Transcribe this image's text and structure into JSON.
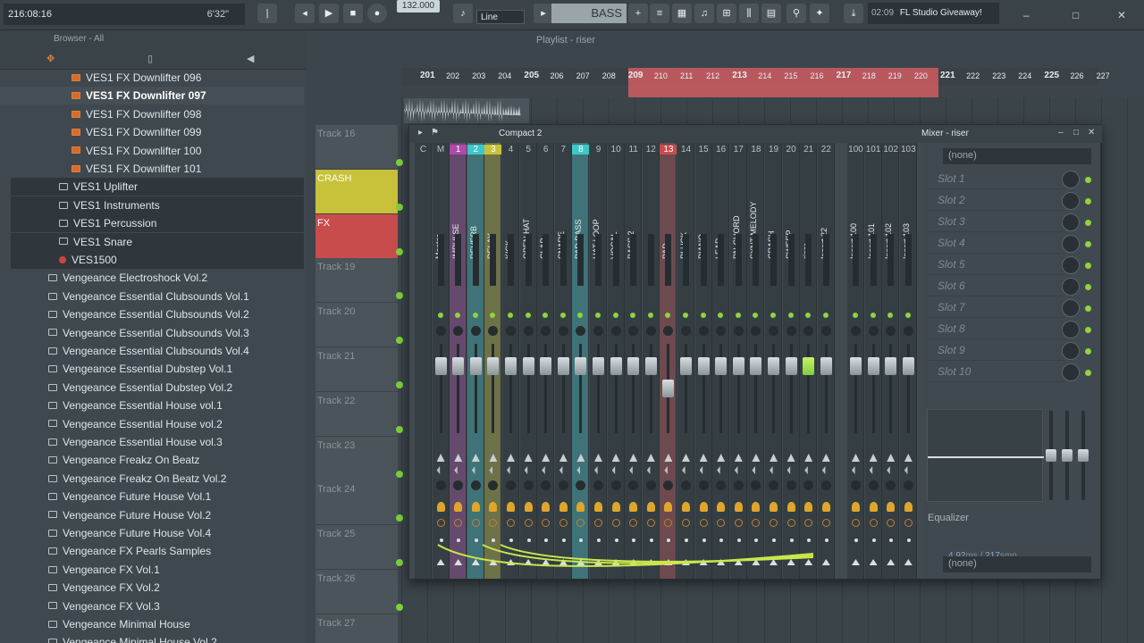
{
  "toolbar": {
    "hint_time": "216:08:16",
    "hint_right": "6'32\"",
    "tempo": "132.000",
    "line_mode": "Line",
    "pattern_name": "BASS",
    "news_time": "02:09",
    "news_text": "FL Studio Giveaway!"
  },
  "browser": {
    "title": "Browser - All",
    "items": [
      {
        "label": "VES1 FX Downlifter 096",
        "kind": "file"
      },
      {
        "label": "VES1 FX Downlifter 097",
        "kind": "file",
        "selected": true
      },
      {
        "label": "VES1 FX Downlifter 098",
        "kind": "file"
      },
      {
        "label": "VES1 FX Downlifter 099",
        "kind": "file"
      },
      {
        "label": "VES1 FX Downlifter 100",
        "kind": "file"
      },
      {
        "label": "VES1 FX Downlifter 101",
        "kind": "file"
      },
      {
        "label": "VES1 Uplifter",
        "kind": "folder"
      },
      {
        "label": "VES1 Instruments",
        "kind": "folder"
      },
      {
        "label": "VES1 Percussion",
        "kind": "folder"
      },
      {
        "label": "VES1 Snare",
        "kind": "folder"
      },
      {
        "label": "VES1500",
        "kind": "pack"
      },
      {
        "label": "Vengeance Electroshock Vol.2",
        "kind": "folder"
      },
      {
        "label": "Vengeance Essential Clubsounds Vol.1",
        "kind": "folder"
      },
      {
        "label": "Vengeance Essential Clubsounds Vol.2",
        "kind": "folder"
      },
      {
        "label": "Vengeance Essential Clubsounds Vol.3",
        "kind": "folder"
      },
      {
        "label": "Vengeance Essential Clubsounds Vol.4",
        "kind": "folder"
      },
      {
        "label": "Vengeance Essential Dubstep Vol.1",
        "kind": "folder"
      },
      {
        "label": "Vengeance Essential Dubstep Vol.2",
        "kind": "folder"
      },
      {
        "label": "Vengeance Essential House vol.1",
        "kind": "folder"
      },
      {
        "label": "Vengeance Essential House vol.2",
        "kind": "folder"
      },
      {
        "label": "Vengeance Essential House vol.3",
        "kind": "folder"
      },
      {
        "label": "Vengeance Freakz On Beatz",
        "kind": "folder"
      },
      {
        "label": "Vengeance Freakz On Beatz Vol.2",
        "kind": "folder"
      },
      {
        "label": "Vengeance Future House Vol.1",
        "kind": "folder"
      },
      {
        "label": "Vengeance Future House Vol.2",
        "kind": "folder"
      },
      {
        "label": "Vengeance Future House Vol.4",
        "kind": "folder"
      },
      {
        "label": "Vengeance FX Pearls Samples",
        "kind": "folder"
      },
      {
        "label": "Vengeance FX Vol.1",
        "kind": "folder"
      },
      {
        "label": "Vengeance FX Vol.2",
        "kind": "folder"
      },
      {
        "label": "Vengeance FX Vol.3",
        "kind": "folder"
      },
      {
        "label": "Vengeance Minimal House",
        "kind": "folder"
      },
      {
        "label": "Vengeance Minimal House Vol.2",
        "kind": "folder"
      }
    ]
  },
  "playlist": {
    "title": "Playlist - riser",
    "ruler": [
      "201",
      "202",
      "203",
      "204",
      "205",
      "206",
      "207",
      "208",
      "209",
      "210",
      "211",
      "212",
      "213",
      "214",
      "215",
      "216",
      "217",
      "218",
      "219",
      "220",
      "221",
      "222",
      "223",
      "224",
      "225",
      "226",
      "227"
    ],
    "tracks": [
      "Track 16",
      "CRASH",
      "FX",
      "Track 19",
      "Track 20",
      "Track 21",
      "Track 22",
      "Track 23",
      "Track 24",
      "Track 25",
      "Track 26",
      "Track 27"
    ]
  },
  "mixer": {
    "title": "Mixer - riser",
    "layout": "Compact 2",
    "strips": [
      {
        "num": "C",
        "name": "",
        "color": ""
      },
      {
        "num": "M",
        "name": "Master",
        "color": ""
      },
      {
        "num": "1",
        "name": "IMPULSE",
        "color": "#b04aa8"
      },
      {
        "num": "2",
        "name": "REVERB",
        "color": "#3ec7c8"
      },
      {
        "num": "3",
        "name": "DELAY",
        "color": "#c8c23a"
      },
      {
        "num": "4",
        "name": "KICK",
        "color": ""
      },
      {
        "num": "5",
        "name": "OPEN HAT",
        "color": ""
      },
      {
        "num": "6",
        "name": "CLAP",
        "color": ""
      },
      {
        "num": "7",
        "name": "SNARE",
        "color": ""
      },
      {
        "num": "8",
        "name": "PAD BASS",
        "color": "#3ec7c8"
      },
      {
        "num": "9",
        "name": "HAT LOOP",
        "color": ""
      },
      {
        "num": "10",
        "name": "VOCAL",
        "color": ""
      },
      {
        "num": "11",
        "name": "BASS 2",
        "color": ""
      },
      {
        "num": "12",
        "name": "---",
        "color": ""
      },
      {
        "num": "13",
        "name": "PAD",
        "color": "#c94c4c"
      },
      {
        "num": "14",
        "name": "PLUCK",
        "color": ""
      },
      {
        "num": "15",
        "name": "PIANO",
        "color": ""
      },
      {
        "num": "16",
        "name": "LEAD",
        "color": ""
      },
      {
        "num": "17",
        "name": "PN-CHORD",
        "color": ""
      },
      {
        "num": "18",
        "name": "SYNT MELODY",
        "color": ""
      },
      {
        "num": "19",
        "name": "CRASH",
        "color": ""
      },
      {
        "num": "20",
        "name": "SWEEP",
        "color": ""
      },
      {
        "num": "21",
        "name": "riser",
        "color": ""
      },
      {
        "num": "22",
        "name": "Insert 22",
        "color": ""
      },
      {
        "num": "100",
        "name": "Insert 100",
        "color": ""
      },
      {
        "num": "101",
        "name": "Insert 101",
        "color": ""
      },
      {
        "num": "102",
        "name": "Insert 102",
        "color": ""
      },
      {
        "num": "103",
        "name": "Insert 103",
        "color": ""
      }
    ],
    "input": "(none)",
    "output": "(none)",
    "slots": [
      "Slot 1",
      "Slot 2",
      "Slot 3",
      "Slot 4",
      "Slot 5",
      "Slot 6",
      "Slot 7",
      "Slot 8",
      "Slot 9",
      "Slot 10"
    ],
    "eq_label": "Equalizer",
    "latency_ms": "4.92",
    "latency_ms_unit": "ms",
    "latency_smp": "217",
    "latency_smp_unit": "smp"
  }
}
